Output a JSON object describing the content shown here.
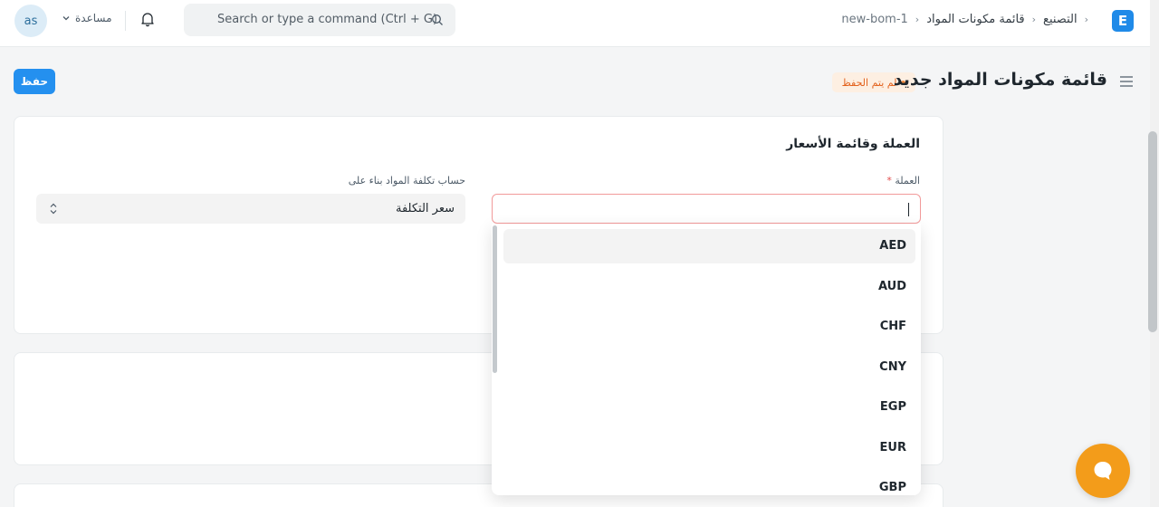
{
  "navbar": {
    "avatar_initials": "as",
    "help_label": "مساعدة",
    "search_placeholder": "Search or type a command (Ctrl + G)",
    "breadcrumb": [
      "التصنيع",
      "قائمة مكونات المواد",
      "new-bom-1"
    ],
    "logo_letter": "E"
  },
  "header": {
    "title": "قائمة مكونات المواد جديد",
    "status_badge": "لم يتم الحفظ",
    "save_label": "حفظ"
  },
  "form": {
    "section_title": "العملة وقائمة الأسعار",
    "currency_label": "العملة",
    "currency_required_mark": "*",
    "currency_value": "",
    "rm_cost_label": "حساب تكلفة المواد بناء على",
    "rm_cost_value": "سعر التكلفة"
  },
  "currency_dropdown": {
    "options": [
      "AED",
      "AUD",
      "CHF",
      "CNY",
      "EGP",
      "EUR",
      "GBP"
    ],
    "highlighted": "AED"
  },
  "colors": {
    "primary": "#2490ef",
    "unsaved_text": "#e3621d",
    "unsaved_bg": "#fdefe2",
    "error_border": "#f29a9a",
    "chat": "#f39c1a"
  },
  "icons": [
    "chevron-down-icon",
    "bell-icon",
    "search-icon",
    "hamburger-icon",
    "select-arrows-icon",
    "chat-icon"
  ]
}
